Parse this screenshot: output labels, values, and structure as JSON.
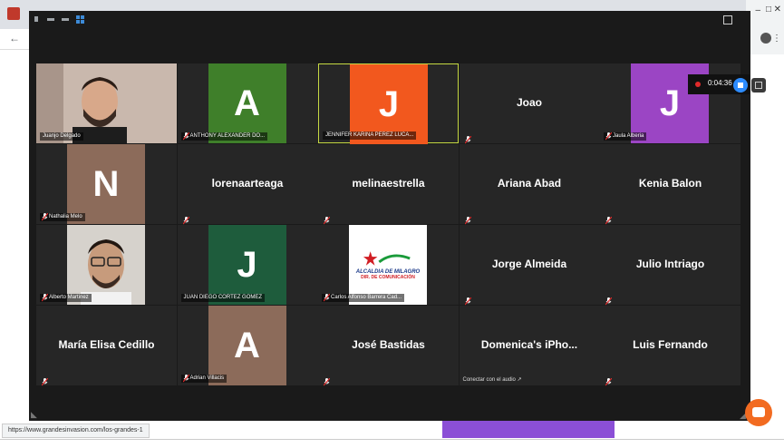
{
  "browser": {
    "status_url": "https://www.grandesinvasion.com/los-grandes-1"
  },
  "recording": {
    "time": "0:04:36"
  },
  "participants": [
    {
      "name": "Juanjo Delgado",
      "type": "video",
      "label": "Juanjo Delgado",
      "muted": false
    },
    {
      "name": "ANTHONY ALEXANDER DO...",
      "type": "avatar",
      "letter": "A",
      "color": "#3f7f2a",
      "label": "ANTHONY ALEXANDER DO...",
      "muted": true
    },
    {
      "name": "JENNIFER KARINA PEREZ LUCA...",
      "type": "avatar",
      "letter": "J",
      "color": "#f2581e",
      "label": "JENNIFER KARINA PEREZ LUCA...",
      "muted": false,
      "active": true
    },
    {
      "name": "Joao",
      "type": "name",
      "muted": true
    },
    {
      "name": "Jaula Alberia",
      "type": "avatar",
      "letter": "J",
      "color": "#9b45c4",
      "label": "Jaula Alberia",
      "muted": true
    },
    {
      "name": "Nathalia Melo",
      "type": "avatar",
      "letter": "N",
      "color": "#8c6b5a",
      "label": "Nathalia Melo",
      "muted": true
    },
    {
      "name": "lorenaarteaga",
      "type": "name",
      "muted": true
    },
    {
      "name": "melinaestrella",
      "type": "name",
      "muted": true
    },
    {
      "name": "Ariana Abad",
      "type": "name",
      "muted": true
    },
    {
      "name": "Kenia Balon",
      "type": "name",
      "muted": true
    },
    {
      "name": "Alberto Martinez",
      "type": "video2",
      "label": "Alberto Martinez",
      "muted": true
    },
    {
      "name": "JUAN DIEGO CORTEZ GOMEZ",
      "type": "avatar",
      "letter": "J",
      "color": "#1e5c3c",
      "label": "JUAN DIEGO CORTEZ GOMEZ",
      "muted": false
    },
    {
      "name": "Carlos Alfonso Barrera Cad...",
      "type": "logo",
      "label": "Carlos Alfonso Barrera Cad...",
      "logo_line1": "ALCALDIA DE MILAGRO",
      "logo_line2": "DIR. DE COMUNICACIÓN",
      "muted": true
    },
    {
      "name": "Jorge Almeida",
      "type": "name",
      "muted": true
    },
    {
      "name": "Julio Intriago",
      "type": "name",
      "muted": true
    },
    {
      "name": "María Elisa Cedillo",
      "type": "name",
      "muted": true
    },
    {
      "name": "Adrian Villacis",
      "type": "avatar",
      "letter": "A",
      "color": "#8c6b5a",
      "label": "Adrian Villacis",
      "muted": true
    },
    {
      "name": "José Bastidas",
      "type": "name",
      "muted": true
    },
    {
      "name": "Domenica's iPho...",
      "type": "name",
      "sub": "Conectar con el audio",
      "muted": false
    },
    {
      "name": "Luis Fernando",
      "type": "name",
      "muted": true
    }
  ],
  "colors": {
    "active_border": "#c6d943",
    "tile_bg": "#262626",
    "window_bg": "#1a1a1a",
    "chat_button": "#f26b21"
  }
}
